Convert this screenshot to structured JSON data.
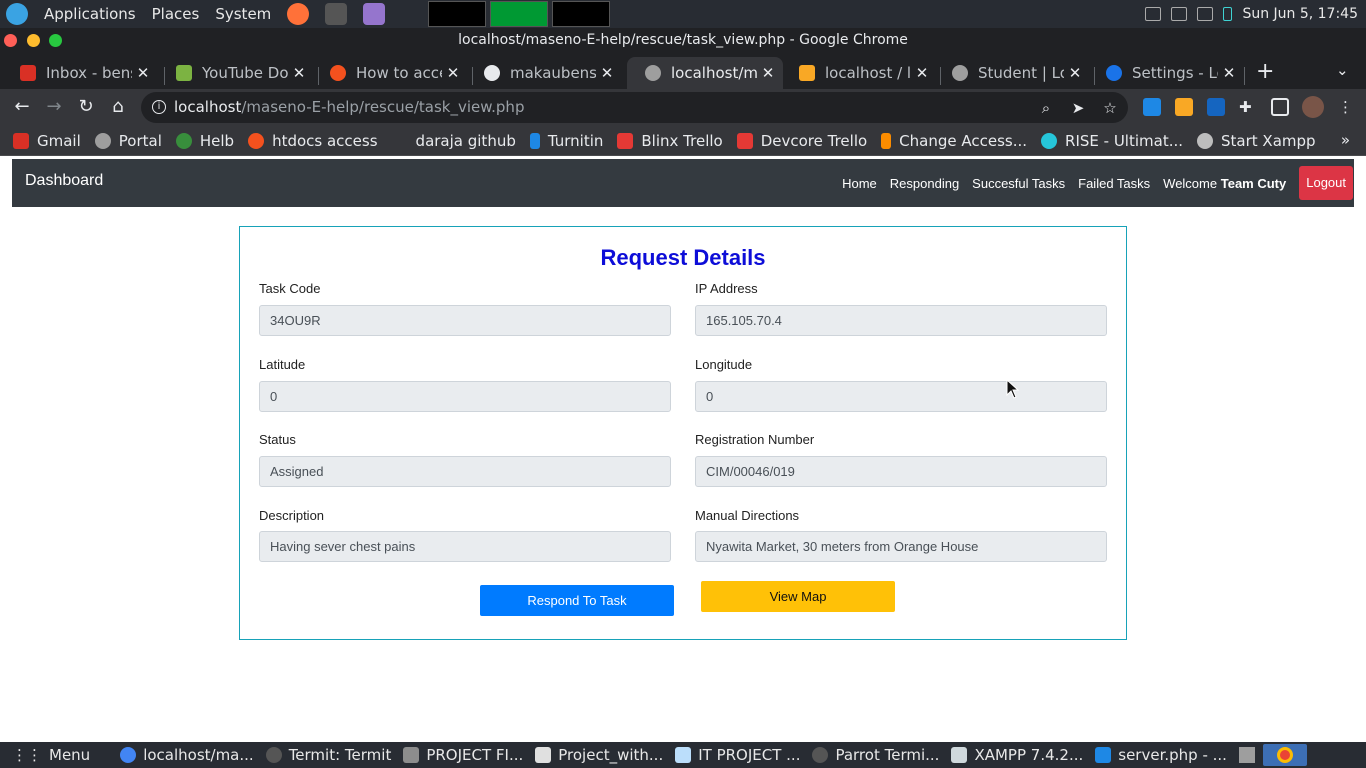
{
  "os_panel": {
    "menu": [
      "Applications",
      "Places",
      "System"
    ],
    "clock": "Sun Jun  5, 17:45"
  },
  "window": {
    "title": "localhost/maseno-E-help/rescue/task_view.php - Google Chrome"
  },
  "tabs": [
    {
      "label": "Inbox - benso",
      "color": "#d93025"
    },
    {
      "label": "YouTube Dow",
      "color": "#7cb342"
    },
    {
      "label": "How to access",
      "color": "#f4511e"
    },
    {
      "label": "makaubenson",
      "color": "#e8eaed"
    },
    {
      "label": "localhost/ma",
      "color": "#9e9e9e"
    },
    {
      "label": "localhost / lo",
      "color": "#f9a825"
    },
    {
      "label": "Student | Log",
      "color": "#9e9e9e"
    },
    {
      "label": "Settings - Lo",
      "color": "#1a73e8"
    }
  ],
  "address_bar": {
    "host": "localhost",
    "path": "/maseno-E-help/rescue/task_view.php"
  },
  "bookmarks": [
    {
      "label": "Gmail",
      "color": "#d93025"
    },
    {
      "label": "Portal",
      "color": "#9e9e9e"
    },
    {
      "label": "Helb",
      "color": "#388e3c"
    },
    {
      "label": "htdocs access",
      "color": "#f4511e"
    },
    {
      "label": "daraja github",
      "color": "transparent"
    },
    {
      "label": "Turnitin",
      "color": "#1e88e5"
    },
    {
      "label": "Blinx Trello",
      "color": "#e53935"
    },
    {
      "label": "Devcore Trello",
      "color": "#e53935"
    },
    {
      "label": "Change Access...",
      "color": "#fb8c00"
    },
    {
      "label": "RISE - Ultimat...",
      "color": "#26c6da"
    },
    {
      "label": "Start Xampp",
      "color": "#bdbdbd"
    }
  ],
  "navbar": {
    "brand": "Dashboard",
    "links": [
      "Home",
      "Responding",
      "Succesful Tasks",
      "Failed Tasks"
    ],
    "welcome": "Welcome",
    "team": "Team Cuty",
    "logout": "Logout"
  },
  "details": {
    "title": "Request Details",
    "task_code_label": "Task Code",
    "task_code": "34OU9R",
    "ip_label": "IP Address",
    "ip": "165.105.70.4",
    "lat_label": "Latitude",
    "lat": "0",
    "lng_label": "Longitude",
    "lng": "0",
    "status_label": "Status",
    "status": "Assigned",
    "reg_label": "Registration Number",
    "reg": "CIM/00046/019",
    "desc_label": "Description",
    "desc": "Having sever chest pains",
    "dir_label": "Manual Directions",
    "dir": "Nyawita Market, 30 meters from Orange House",
    "respond_button": "Respond To Task",
    "map_button": "View Map"
  },
  "taskbar": [
    {
      "label": "Menu"
    },
    {
      "label": "localhost/ma..."
    },
    {
      "label": "Termit: Termit"
    },
    {
      "label": "PROJECT FI..."
    },
    {
      "label": "Project_with..."
    },
    {
      "label": "IT PROJECT ..."
    },
    {
      "label": "Parrot Termi..."
    },
    {
      "label": "XAMPP 7.4.2..."
    },
    {
      "label": "server.php - ..."
    }
  ]
}
